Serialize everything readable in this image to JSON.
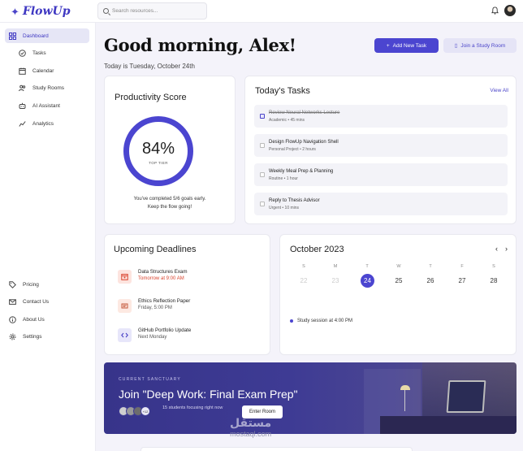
{
  "app": {
    "name": "FlowUp",
    "logo_icon": "sparkle-icon"
  },
  "search": {
    "placeholder": "Search resources..."
  },
  "sidebar": {
    "items": [
      {
        "label": "Dashboard",
        "icon": "grid-icon",
        "active": true
      },
      {
        "label": "Tasks",
        "icon": "check-circle-icon"
      },
      {
        "label": "Calendar",
        "icon": "calendar-icon"
      },
      {
        "label": "Study Rooms",
        "icon": "users-icon"
      },
      {
        "label": "AI Assistant",
        "icon": "robot-icon"
      },
      {
        "label": "Analytics",
        "icon": "chart-line-icon"
      }
    ],
    "footer": [
      {
        "label": "Pricing",
        "icon": "tag-icon"
      },
      {
        "label": "Contact Us",
        "icon": "mail-icon"
      },
      {
        "label": "About Us",
        "icon": "info-icon"
      },
      {
        "label": "Settings",
        "icon": "gear-icon"
      }
    ]
  },
  "header": {
    "greeting": "Good morning, Alex!",
    "date": "Today is Tuesday, October 24th",
    "add_task": "Add New Task",
    "join_room": "Join a Study Room"
  },
  "productivity": {
    "title": "Productivity Score",
    "value_label": "84%",
    "value": 84,
    "tier": "TOP TIER",
    "note_line1": "You've completed 5/6 goals early.",
    "note_line2": "Keep the flow going!"
  },
  "tasks": {
    "title": "Today's Tasks",
    "view_all": "View All",
    "items": [
      {
        "title": "Review Neural Networks Lecture",
        "meta": "Academic • 45 mins",
        "done": true
      },
      {
        "title": "Design FlowUp Navigation Shell",
        "meta": "Personal Project • 2 hours",
        "done": false
      },
      {
        "title": "Weekly Meal Prep & Planning",
        "meta": "Routine • 1 hour",
        "done": false
      },
      {
        "title": "Reply to Thesis Advisor",
        "meta": "Urgent • 10 mins",
        "done": false
      }
    ]
  },
  "deadlines": {
    "title": "Upcoming Deadlines",
    "items": [
      {
        "name": "Data Structures Exam",
        "when": "Tomorrow at 9:00 AM",
        "urgent": true,
        "icon": "calendar-icon"
      },
      {
        "name": "Ethics Reflection Paper",
        "when": "Friday, 5:00 PM",
        "urgent": false,
        "icon": "document-icon"
      },
      {
        "name": "GitHub Portfolio Update",
        "when": "Next Monday",
        "urgent": false,
        "icon": "code-icon"
      }
    ]
  },
  "calendar": {
    "title": "October 2023",
    "prev": "‹",
    "next": "›",
    "weekdays": [
      "S",
      "M",
      "T",
      "W",
      "T",
      "F",
      "S"
    ],
    "days": [
      "22",
      "23",
      "24",
      "25",
      "26",
      "27",
      "28"
    ],
    "today": "24",
    "event": "Study session at 4:00 PM"
  },
  "banner": {
    "kicker": "CURRENT SANCTUARY",
    "title": "Join \"Deep Work: Final Exam Prep\"",
    "more": "+12",
    "subtitle": "15 students focusing right now",
    "button": "Enter Room"
  },
  "watermark": {
    "arabic": "مستقل",
    "latin": "mostaql.com"
  },
  "colors": {
    "accent": "#4b45d0",
    "urgent": "#d9442f",
    "background": "#f4f3fa"
  }
}
